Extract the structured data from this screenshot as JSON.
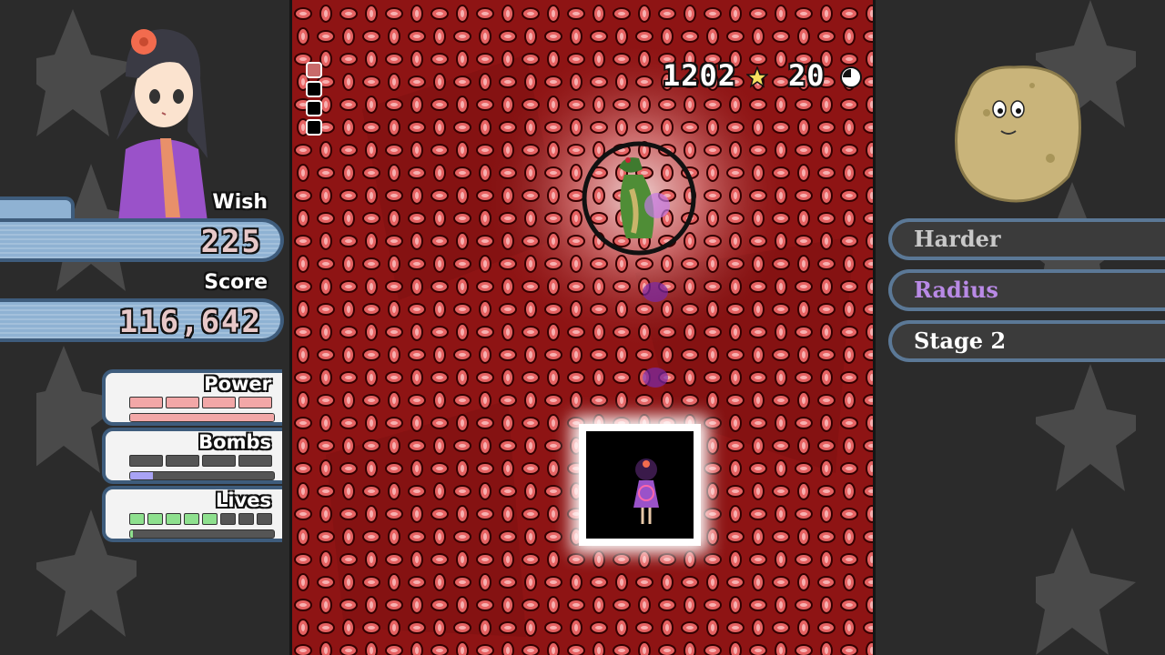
{
  "left_panel": {
    "wish": {
      "label": "Wish",
      "value": "225"
    },
    "score": {
      "label": "Score",
      "value": "116,642"
    },
    "power": {
      "label": "Power",
      "cells_filled": 4,
      "cells_total": 4,
      "gauge_fraction": 1.0
    },
    "bombs": {
      "label": "Bombs",
      "cells_filled": 0,
      "cells_total": 4,
      "gauge_fraction": 0.16
    },
    "lives": {
      "label": "Lives",
      "cells_filled": 5,
      "cells_total": 8,
      "gauge_fraction": 0.02
    }
  },
  "hud": {
    "star_count": "1202",
    "timer": "20",
    "slots_total": 4,
    "slots_filled": 1
  },
  "right_panel": {
    "menu": [
      {
        "label": "Harder",
        "color": "#c9c9c9"
      },
      {
        "label": "Radius",
        "color": "#b98ae6"
      },
      {
        "label": "Stage 2",
        "color": "#ffffff"
      }
    ]
  },
  "icons": {
    "star": "star-icon",
    "clock": "clock-icon"
  },
  "colors": {
    "field": "#8e1414",
    "bullet": "#e65a5a",
    "power": "#f2a7a7",
    "bombs_gauge": "#a9a3f5",
    "lives": "#8ee08e",
    "bar": "#8fb2d3"
  }
}
